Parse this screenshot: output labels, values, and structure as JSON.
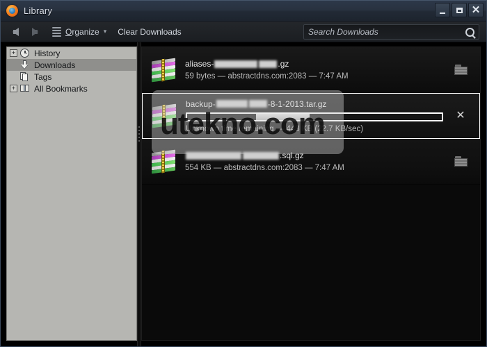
{
  "window": {
    "title": "Library",
    "app_icon": "firefox-icon",
    "controls": {
      "minimize": "minimize-icon",
      "maximize": "maximize-icon",
      "close": "close-icon"
    }
  },
  "toolbar": {
    "back": "back-arrow-icon",
    "forward": "forward-arrow-icon",
    "organize_label_pre": "O",
    "organize_label_post": "rganize",
    "organize_full": "Organize",
    "clear_downloads_label": "Clear Downloads",
    "dropdown_chevron": "▾"
  },
  "search": {
    "placeholder": "Search Downloads",
    "value": "",
    "icon": "search-icon"
  },
  "sidebar": {
    "items": [
      {
        "label": "History",
        "icon": "clock-icon",
        "twisty": "+",
        "selected": false
      },
      {
        "label": "Downloads",
        "icon": "download-icon",
        "twisty": "",
        "selected": true
      },
      {
        "label": "Tags",
        "icon": "tag-icon",
        "twisty": "",
        "selected": false
      },
      {
        "label": "All Bookmarks",
        "icon": "folder-icon",
        "twisty": "+",
        "selected": false
      }
    ]
  },
  "downloads": {
    "items": [
      {
        "name_prefix": "aliases-",
        "name_suffix": ".gz",
        "redacted": true,
        "status": "59 bytes — abstractdns.com:2083 — 7:47 AM",
        "state": "complete",
        "action": "open-containing-folder",
        "selected": false
      },
      {
        "name_prefix": "backup-",
        "name_suffix": "-8-1-2013.tar.gz",
        "redacted": true,
        "status": "Unknown time remaining — 448 KB (22.7 KB/sec)",
        "state": "downloading",
        "progress_start_pct": 27,
        "progress_width_pct": 21,
        "action": "cancel-download",
        "selected": true
      },
      {
        "name_prefix": "",
        "name_suffix": ".sql.gz",
        "redacted": true,
        "status": "554 KB — abstractdns.com:2083 — 7:47 AM",
        "state": "complete",
        "action": "open-containing-folder",
        "selected": false
      }
    ]
  },
  "watermark": {
    "text": "utekno.com"
  },
  "colors": {
    "titlebar": "#2d3849",
    "toolbar": "#20232a",
    "sidebar_bg": "#b6b6b2",
    "list_bg": "#0a0a0a",
    "selection_outline": "#ffffff",
    "text_light": "#e8e8e8"
  }
}
